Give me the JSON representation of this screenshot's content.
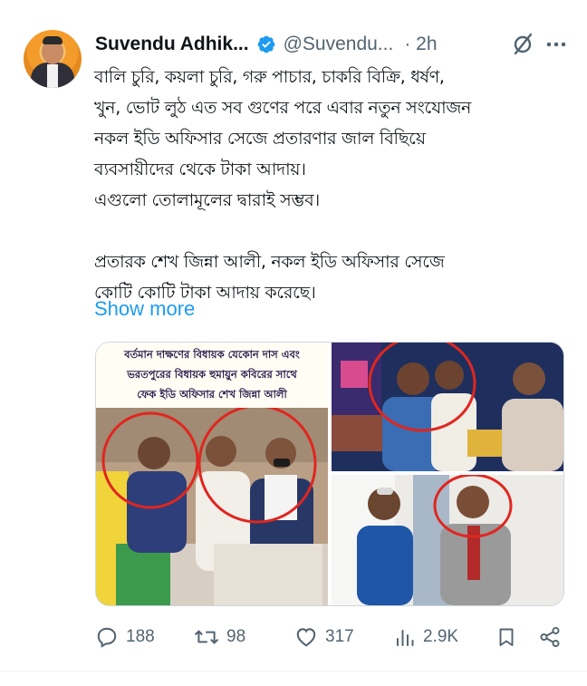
{
  "author": {
    "name": "Suvendu Adhik...",
    "handle": "@Suvendu...",
    "time": "· 2h",
    "verified_color": "#1d9bf0"
  },
  "tweet": {
    "text": "বালি চুরি, কয়লা চুরি, গরু পাচার, চাকরি বিক্রি, ধর্ষণ,\nখুন, ভোট লুঠ এত সব গুণের পরে এবার নতুন সংযোজন\nনকল ইডি অফিসার সেজে প্রতারণার জাল বিছিয়ে\nব্যবসায়ীদের থেকে টাকা আদায়।\nএগুলো তোলামূলের দ্বারাই সম্ভব।\n\nপ্রতারক শেখ জিন্না আলী, নকল ইডি অফিসার সেজে\nকোটি কোটি টাকা আদায় করেছে।",
    "show_more": "Show more"
  },
  "media": {
    "caption_line1": "বর্তমান দাক্ষণের বিধায়ক যেকোন দাস এবং",
    "caption_line2": "ভরতপুরের বিধায়ক হুমায়ুন কবিরের সাথে",
    "caption_line3": "ফেক ইডি অফিসার শেখ জিন্না আলী"
  },
  "actions": {
    "replies": "188",
    "reposts": "98",
    "likes": "317",
    "views": "2.9K"
  },
  "icons": {
    "reply": "reply-icon",
    "repost": "repost-icon",
    "like": "heart-icon",
    "views": "views-icon",
    "bookmark": "bookmark-icon",
    "share": "share-icon",
    "grok": "grok-icon",
    "more": "more-icon"
  },
  "colors": {
    "accent": "#1d9bf0",
    "muted": "#536471",
    "highlight_circle": "#e0261f"
  }
}
